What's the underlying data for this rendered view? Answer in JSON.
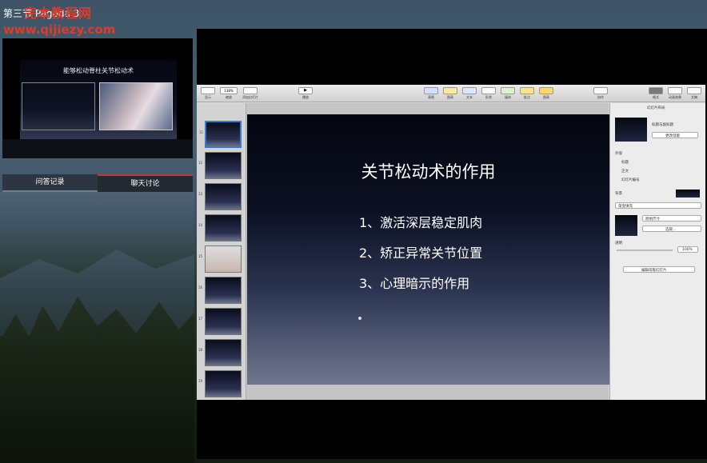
{
  "watermark": {
    "line1": "完本教程网",
    "line2": "www.qijiezy.com"
  },
  "page_title": "第三节 Pagoda 3",
  "mini_preview": {
    "title": "能够松动脊柱关节松动术"
  },
  "tabs": [
    {
      "label": "问答记录"
    },
    {
      "label": "聊天讨论"
    }
  ],
  "toolbar": {
    "view": "显示",
    "zoom_value": "138%",
    "zoom_label": "缩放",
    "add_slide": "添加幻灯片",
    "play": "播放",
    "table": "表格",
    "chart": "图表",
    "text": "文本",
    "shape": "形状",
    "media": "媒体",
    "comment": "批注",
    "collab": "协作",
    "format": "格式",
    "animate": "动画效果",
    "document": "文稿",
    "sheet": "图表"
  },
  "slide": {
    "title": "关节松动术的作用",
    "bullets": [
      "1、激活深层稳定肌肉",
      "2、矫正异常关节位置",
      "3、心理暗示的作用"
    ]
  },
  "thumbnail_numbers": [
    "11",
    "12",
    "13",
    "14",
    "15",
    "16",
    "17",
    "18",
    "19",
    "20"
  ],
  "inspector": {
    "header": "幻灯片布局",
    "layout_name": "标题与副标题",
    "change_master": "更改母版",
    "appearance": "外观",
    "opt_title": "标题",
    "opt_body": "正文",
    "opt_number": "幻灯片编号",
    "background": "背景",
    "fill_type": "渐变填充",
    "image_fit": "原始尺寸",
    "select": "选取...",
    "opacity_label": "透明",
    "opacity_value": "100%",
    "edit_master": "编辑母版幻灯片"
  }
}
